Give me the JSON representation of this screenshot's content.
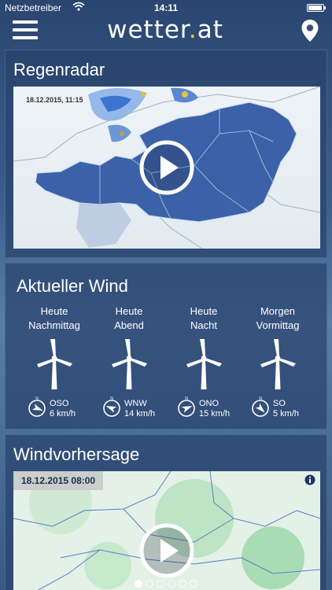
{
  "status_bar": {
    "carrier": "Netzbetreiber",
    "time": "14:11"
  },
  "header": {
    "logo_main": "wetter",
    "logo_dot": ".",
    "logo_tld": "at",
    "menu_icon": "hamburger-menu-icon",
    "location_icon": "location-pin-icon"
  },
  "radar": {
    "title": "Regenradar",
    "timestamp": "18.12.2015, 11:15",
    "play_icon": "play-icon"
  },
  "wind": {
    "title": "Aktueller Wind",
    "columns": [
      {
        "line1": "Heute",
        "line2": "Nachmittag",
        "direction": "OSO",
        "speed": "6 km/h",
        "compass_deg": 112
      },
      {
        "line1": "Heute",
        "line2": "Abend",
        "direction": "WNW",
        "speed": "14 km/h",
        "compass_deg": 292
      },
      {
        "line1": "Heute",
        "line2": "Nacht",
        "direction": "ONO",
        "speed": "15 km/h",
        "compass_deg": 68
      },
      {
        "line1": "Morgen",
        "line2": "Vormittag",
        "direction": "SO",
        "speed": "5 km/h",
        "compass_deg": 135
      }
    ],
    "compass_north_label": "N"
  },
  "forecast": {
    "title": "Windvorhersage",
    "timestamp": "18.12.2015 08:00",
    "info_icon": "info-icon",
    "play_icon": "play-icon"
  },
  "pager": {
    "total": 6,
    "active": 0
  },
  "colors": {
    "accent_dot": "#f2d21a",
    "card_bg": "#28426e",
    "map_austria": "#3b62a8"
  }
}
